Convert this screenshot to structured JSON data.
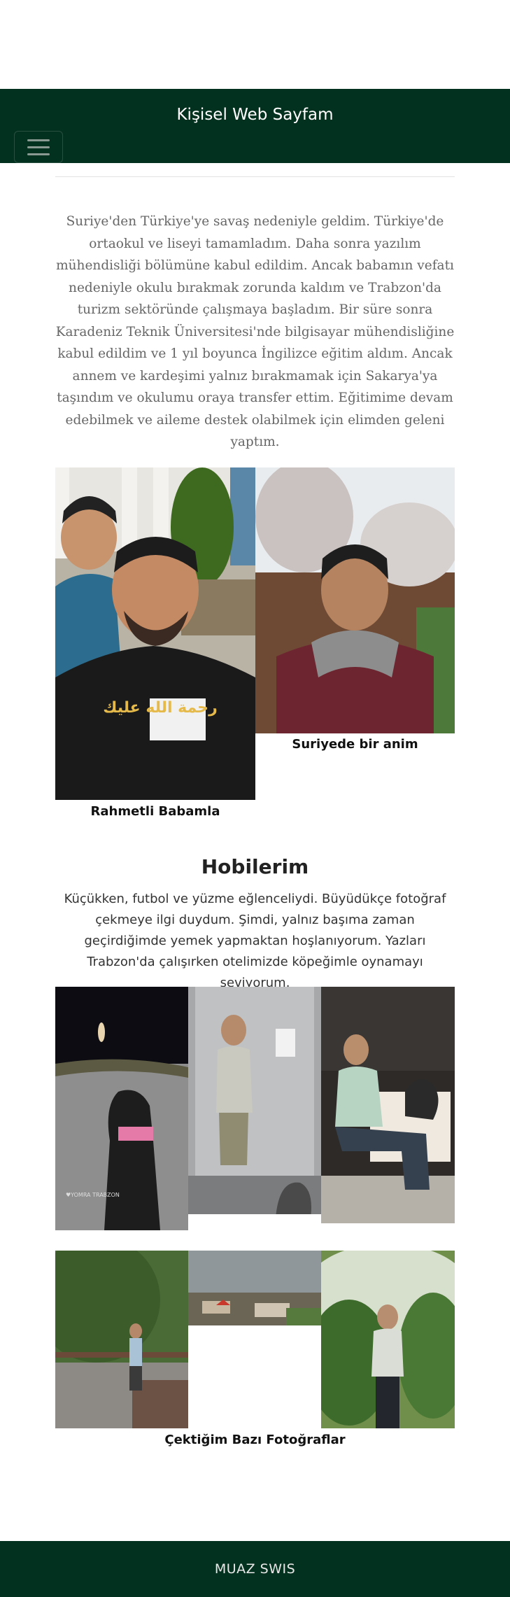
{
  "header": {
    "title": "Kişisel Web Sayfam",
    "menu_icon": "hamburger-menu-icon"
  },
  "intro": {
    "text": "Suriye'den Türkiye'ye savaş nedeniyle geldim. Türkiye'de ortaokul ve liseyi tamamladım. Daha sonra yazılım mühendisliği bölümüne kabul edildim. Ancak babamın vefatı nedeniyle okulu bırakmak zorunda kaldım ve Trabzon'da turizm sektöründe çalışmaya başladım. Bir süre sonra Karadeniz Teknik Üniversitesi'nde bilgisayar mühendisliğine kabul edildim ve 1 yıl boyunca İngilizce eğitim aldım. Ancak annem ve kardeşimi yalnız bırakmamak için Sakarya'ya taşındım ve okulumu oraya transfer ettim. Eğitimime devam edebilmek ve aileme destek olabilmek için elimden geleni yaptım."
  },
  "family_photos": {
    "father_photo_text": "رحمة الله عليك",
    "father_caption": "Rahmetli Babamla",
    "syria_caption": "Suriyede bir anim"
  },
  "hobbies": {
    "title": "Hobilerim",
    "text": "Küçükken, futbol ve yüzme eğlenceliydi. Büyüdükçe fotoğraf çekmeye ilgi duydum. Şimdi, yalnız başıma zaman geçirdiğimde yemek yapmaktan hoşlanıyorum. Yazları Trabzon'da çalışırken otelimizde köpeğimle oynamayı seviyorum.",
    "dog_photo_watermark": "♥YOMRA TRABZON",
    "gallery_caption": "Çektiğim Bazı Fotoğraflar"
  },
  "footer": {
    "text": "MUAZ SWIS"
  },
  "colors": {
    "header_bg": "#03311f",
    "footer_bg": "#03311f",
    "intro_text": "#666666"
  }
}
